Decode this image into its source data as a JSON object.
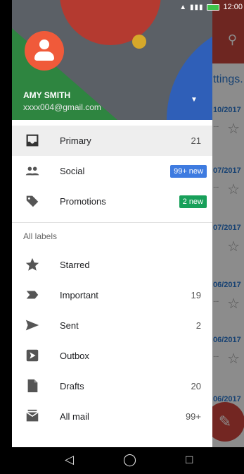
{
  "status_bar": {
    "time": "12:00",
    "signal": "▲ ▮▮▮"
  },
  "background_app": {
    "banner": "ttings.",
    "rows": [
      {
        "date": "10/2017",
        "snippet": "..."
      },
      {
        "date": "07/2017",
        "snippet": "..."
      },
      {
        "date": "07/2017",
        "snippet": ""
      },
      {
        "date": "06/2017",
        "snippet": "..."
      },
      {
        "date": "06/2017",
        "snippet": "..."
      },
      {
        "date": "06/2017",
        "snippet": ""
      }
    ]
  },
  "account": {
    "name": "AMY SMITH",
    "email": "xxxx004@gmail.com"
  },
  "inbox_items": [
    {
      "label": "Primary",
      "count": "21"
    },
    {
      "label": "Social",
      "badge": "99+ new"
    },
    {
      "label": "Promotions",
      "badge": "2 new"
    }
  ],
  "labels_heading": "All labels",
  "label_items": [
    {
      "label": "Starred",
      "count": ""
    },
    {
      "label": "Important",
      "count": "19"
    },
    {
      "label": "Sent",
      "count": "2"
    },
    {
      "label": "Outbox",
      "count": ""
    },
    {
      "label": "Drafts",
      "count": "20"
    },
    {
      "label": "All mail",
      "count": "99+"
    }
  ],
  "colors": {
    "accent_red": "#c9463d",
    "badge_blue": "#3e7be0",
    "badge_green": "#18a05a",
    "avatar": "#f05a3a"
  },
  "icons": [
    "inbox-icon",
    "people-icon",
    "tag-icon",
    "star-icon",
    "important-icon",
    "send-icon",
    "outbox-icon",
    "draft-icon",
    "all-mail-icon",
    "search-icon",
    "compose-icon"
  ]
}
